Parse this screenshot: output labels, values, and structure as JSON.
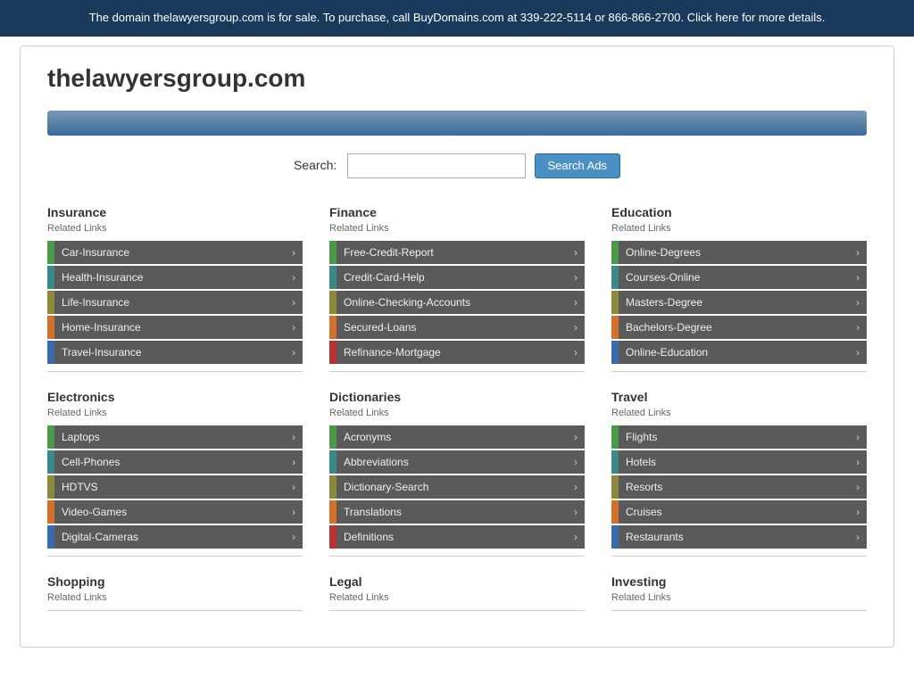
{
  "banner": {
    "text": "The domain thelawyersgroup.com is for sale. To purchase, call BuyDomains.com at 339-222-5114 or 866-866-2700. Click here for more details."
  },
  "site": {
    "title": "thelawyersgroup.com"
  },
  "search": {
    "label": "Search:",
    "placeholder": "",
    "button_label": "Search Ads"
  },
  "categories": [
    {
      "id": "insurance",
      "title": "Insurance",
      "related_label": "Related Links",
      "links": [
        {
          "text": "Car-Insurance",
          "color": "green"
        },
        {
          "text": "Health-Insurance",
          "color": "teal"
        },
        {
          "text": "Life-Insurance",
          "color": "olive"
        },
        {
          "text": "Home-Insurance",
          "color": "orange"
        },
        {
          "text": "Travel-Insurance",
          "color": "blue"
        }
      ]
    },
    {
      "id": "finance",
      "title": "Finance",
      "related_label": "Related Links",
      "links": [
        {
          "text": "Free-Credit-Report",
          "color": "green"
        },
        {
          "text": "Credit-Card-Help",
          "color": "teal"
        },
        {
          "text": "Online-Checking-Accounts",
          "color": "olive"
        },
        {
          "text": "Secured-Loans",
          "color": "orange"
        },
        {
          "text": "Refinance-Mortgage",
          "color": "red"
        }
      ]
    },
    {
      "id": "education",
      "title": "Education",
      "related_label": "Related Links",
      "links": [
        {
          "text": "Online-Degrees",
          "color": "green"
        },
        {
          "text": "Courses-Online",
          "color": "teal"
        },
        {
          "text": "Masters-Degree",
          "color": "olive"
        },
        {
          "text": "Bachelors-Degree",
          "color": "orange"
        },
        {
          "text": "Online-Education",
          "color": "blue"
        }
      ]
    },
    {
      "id": "electronics",
      "title": "Electronics",
      "related_label": "Related Links",
      "links": [
        {
          "text": "Laptops",
          "color": "green"
        },
        {
          "text": "Cell-Phones",
          "color": "teal"
        },
        {
          "text": "HDTVS",
          "color": "olive"
        },
        {
          "text": "Video-Games",
          "color": "orange"
        },
        {
          "text": "Digital-Cameras",
          "color": "blue"
        }
      ]
    },
    {
      "id": "dictionaries",
      "title": "Dictionaries",
      "related_label": "Related Links",
      "links": [
        {
          "text": "Acronyms",
          "color": "green"
        },
        {
          "text": "Abbreviations",
          "color": "teal"
        },
        {
          "text": "Dictionary-Search",
          "color": "olive"
        },
        {
          "text": "Translations",
          "color": "orange"
        },
        {
          "text": "Definitions",
          "color": "red"
        }
      ]
    },
    {
      "id": "travel",
      "title": "Travel",
      "related_label": "Related Links",
      "links": [
        {
          "text": "Flights",
          "color": "green"
        },
        {
          "text": "Hotels",
          "color": "teal"
        },
        {
          "text": "Resorts",
          "color": "olive"
        },
        {
          "text": "Cruises",
          "color": "orange"
        },
        {
          "text": "Restaurants",
          "color": "blue"
        }
      ]
    },
    {
      "id": "shopping",
      "title": "Shopping",
      "related_label": "Related Links",
      "links": []
    },
    {
      "id": "legal",
      "title": "Legal",
      "related_label": "Related Links",
      "links": []
    },
    {
      "id": "investing",
      "title": "Investing",
      "related_label": "Related Links",
      "links": []
    }
  ]
}
